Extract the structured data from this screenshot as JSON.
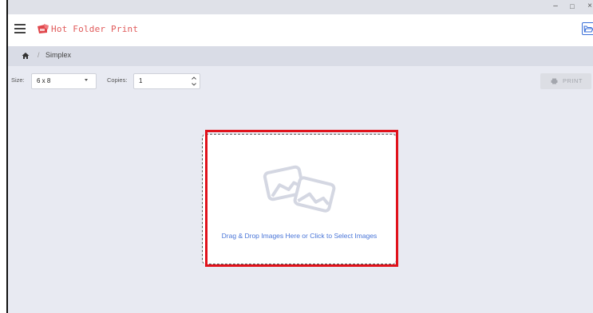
{
  "window": {
    "minimize_glyph": "–",
    "maximize_glyph": "□",
    "close_glyph": "×"
  },
  "header": {
    "title": "Hot Folder Print",
    "menu_icon": "hamburger-menu-icon",
    "logo_icon": "printer-logo-icon",
    "folder_icon": "open-folder-icon"
  },
  "breadcrumb": {
    "home_icon": "home-icon",
    "separator": "/",
    "current": "Simplex"
  },
  "toolbar": {
    "size_label": "Size:",
    "size_value": "6 x 8",
    "copies_label": "Copies:",
    "copies_value": "1",
    "print_label": "PRINT"
  },
  "dropzone": {
    "icon": "images-icon",
    "text": "Drag & Drop Images Here or Click to Select Images"
  },
  "colors": {
    "accent_blue": "#4a76d8",
    "brand_red": "#e05a5a",
    "highlight_red": "#e0121b",
    "background": "#e8eaf2"
  }
}
